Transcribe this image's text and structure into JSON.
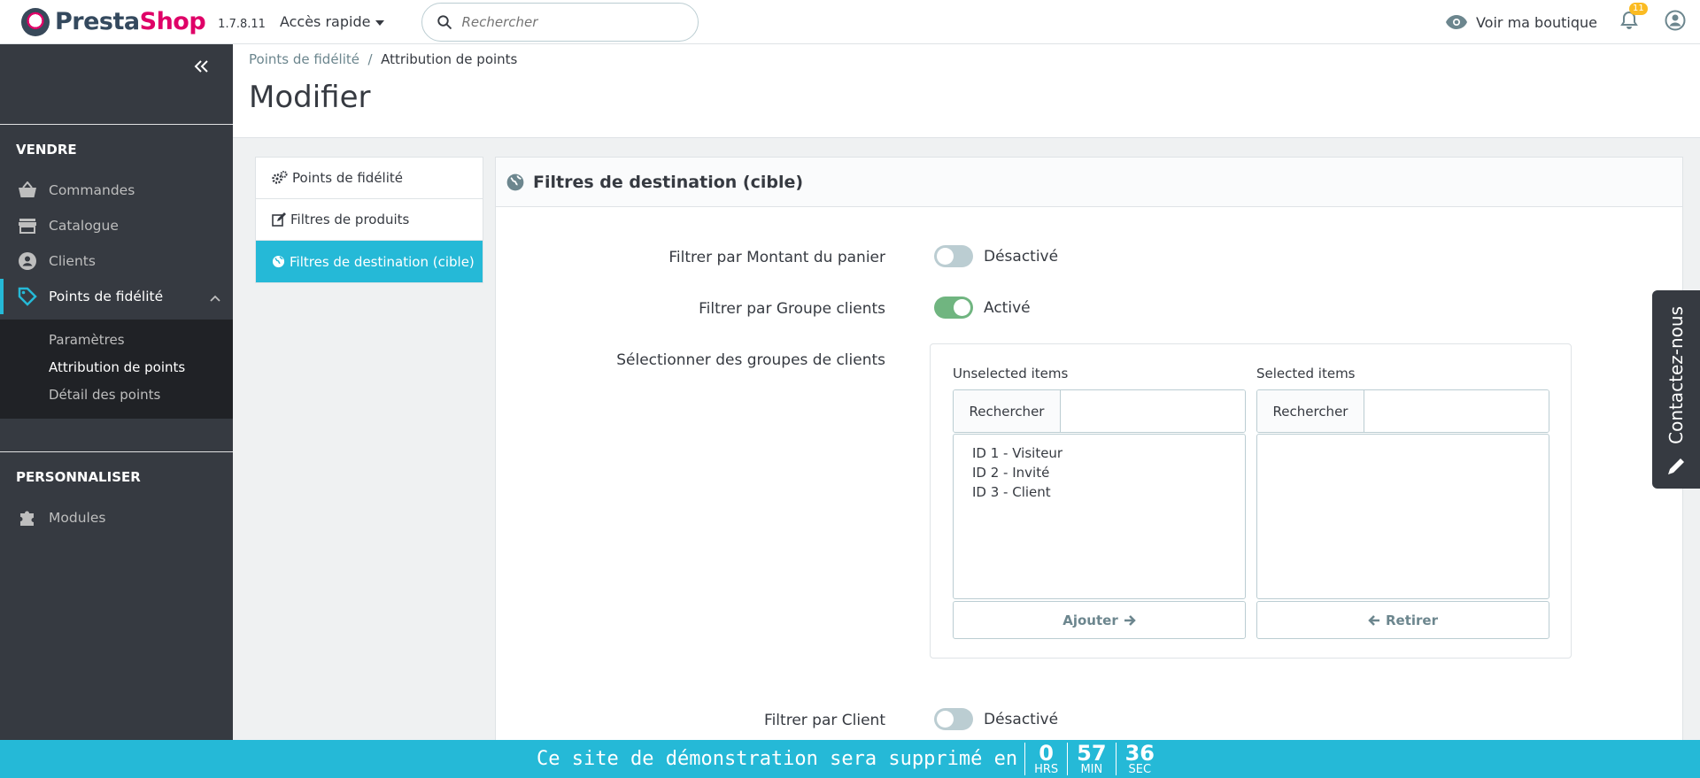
{
  "header": {
    "brand_prefix": "Presta",
    "brand_suffix": "Shop",
    "version": "1.7.8.11",
    "quick_access": "Accès rapide",
    "search_placeholder": "Rechercher",
    "shop_link": "Voir ma boutique",
    "notifications_count": "11"
  },
  "sidebar": {
    "section_sell": "VENDRE",
    "items": [
      {
        "label": "Commandes",
        "icon": "basket-icon"
      },
      {
        "label": "Catalogue",
        "icon": "store-icon"
      },
      {
        "label": "Clients",
        "icon": "account-icon"
      },
      {
        "label": "Points de fidélité",
        "icon": "tag-icon"
      }
    ],
    "submenu": [
      "Paramètres",
      "Attribution de points",
      "Détail des points"
    ],
    "section_customize": "PERSONNALISER",
    "customize_items": [
      {
        "label": "Modules",
        "icon": "puzzle-icon"
      }
    ]
  },
  "page": {
    "breadcrumb_parent": "Points de fidélité",
    "breadcrumb_separator": "/",
    "breadcrumb_current": "Attribution de points",
    "title": "Modifier"
  },
  "tabs": [
    "Points de fidélité",
    "Filtres de produits",
    "Filtres de destination (cible)"
  ],
  "panel": {
    "title": "Filtres de destination (cible)",
    "fields": [
      {
        "label": "Filtrer par Montant du panier",
        "state": "Désactivé",
        "on": false
      },
      {
        "label": "Filtrer par Groupe clients",
        "state": "Activé",
        "on": true
      },
      {
        "label": "Sélectionner des groupes de clients"
      },
      {
        "label": "Filtrer par Client",
        "state": "Désactivé",
        "on": false
      }
    ],
    "dual_list": {
      "unselected_label": "Unselected items",
      "selected_label": "Selected items",
      "search_label": "Rechercher",
      "unselected_items": [
        "ID 1 - Visiteur",
        "ID 2 - Invité",
        "ID 3 - Client"
      ],
      "add_button": "Ajouter",
      "remove_button": "Retirer"
    }
  },
  "contact_tab": "Contactez-nous",
  "demo_bar": {
    "text": "Ce site de démonstration sera supprimé en",
    "hours": "0",
    "hours_unit": "HRS",
    "minutes": "57",
    "minutes_unit": "MIN",
    "seconds": "36",
    "seconds_unit": "SEC"
  },
  "colors": {
    "accent": "#25b9d7",
    "sidebar": "#363a41",
    "toggle_on": "#70b580",
    "toggle_off": "#bbcdd2"
  }
}
